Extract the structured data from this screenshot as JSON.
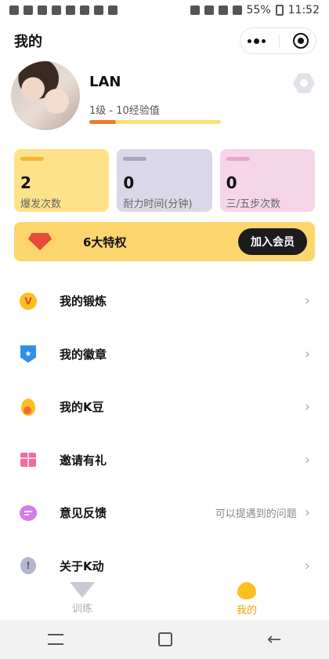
{
  "status_bar": {
    "battery": "55%",
    "time": "11:52"
  },
  "header": {
    "title": "我的"
  },
  "profile": {
    "username": "LAN",
    "level_text": "1级 - 10经验值",
    "level_progress": 0.2
  },
  "stats": [
    {
      "value": "2",
      "label": "爆发次数",
      "bg": "#fde28a",
      "accent": "#f7b430"
    },
    {
      "value": "0",
      "label": "耐力时间(分钟)",
      "bg": "#dad8e8",
      "accent": "#a8a6c2"
    },
    {
      "value": "0",
      "label": "三/五步次数",
      "bg": "#f5d6e8",
      "accent": "#e9a6cc"
    }
  ],
  "vip": {
    "text": "6大特权",
    "button": "加入会员"
  },
  "menu": [
    {
      "label": "我的锻炼",
      "hint": ""
    },
    {
      "label": "我的徽章",
      "hint": ""
    },
    {
      "label": "我的K豆",
      "hint": ""
    },
    {
      "label": "邀请有礼",
      "hint": ""
    },
    {
      "label": "意见反馈",
      "hint": "可以提遇到的问题"
    },
    {
      "label": "关于K动",
      "hint": ""
    }
  ],
  "tabs": {
    "train": "训练",
    "mine": "我的"
  },
  "colors": {
    "accent": "#fbbf1f",
    "vip_bg": "#fdd56d"
  }
}
